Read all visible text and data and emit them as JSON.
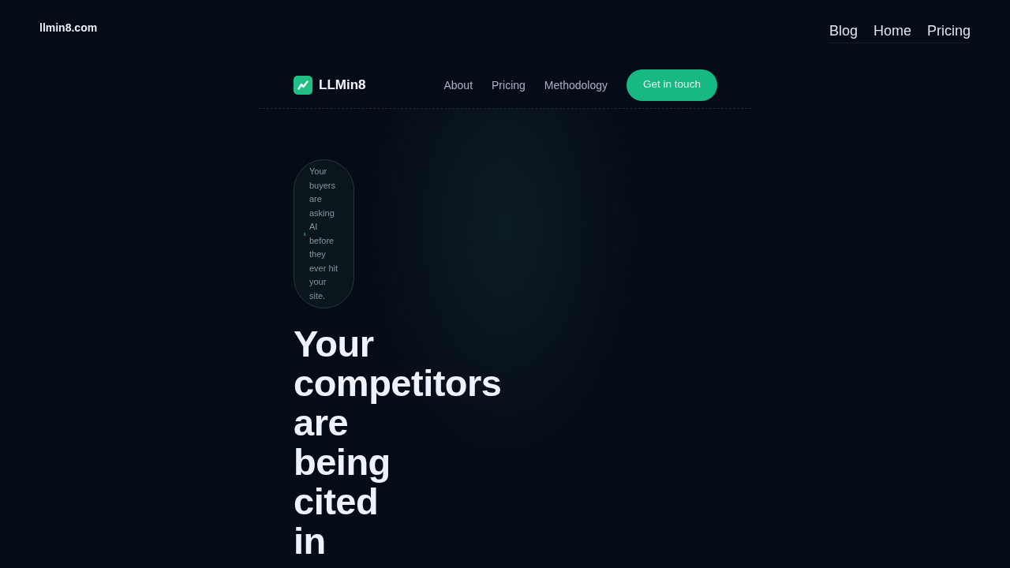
{
  "top_bar": {
    "site_name": "llmin8.com",
    "nav": [
      "Blog",
      "Home",
      "Pricing"
    ]
  },
  "header": {
    "logo_text": "LLMin8",
    "nav": [
      "About",
      "Pricing",
      "Methodology"
    ],
    "cta": "Get in touch"
  },
  "hero": {
    "badge": "Your buyers are asking AI before they ever hit your site.",
    "heading": "Your competitors are being cited in"
  }
}
